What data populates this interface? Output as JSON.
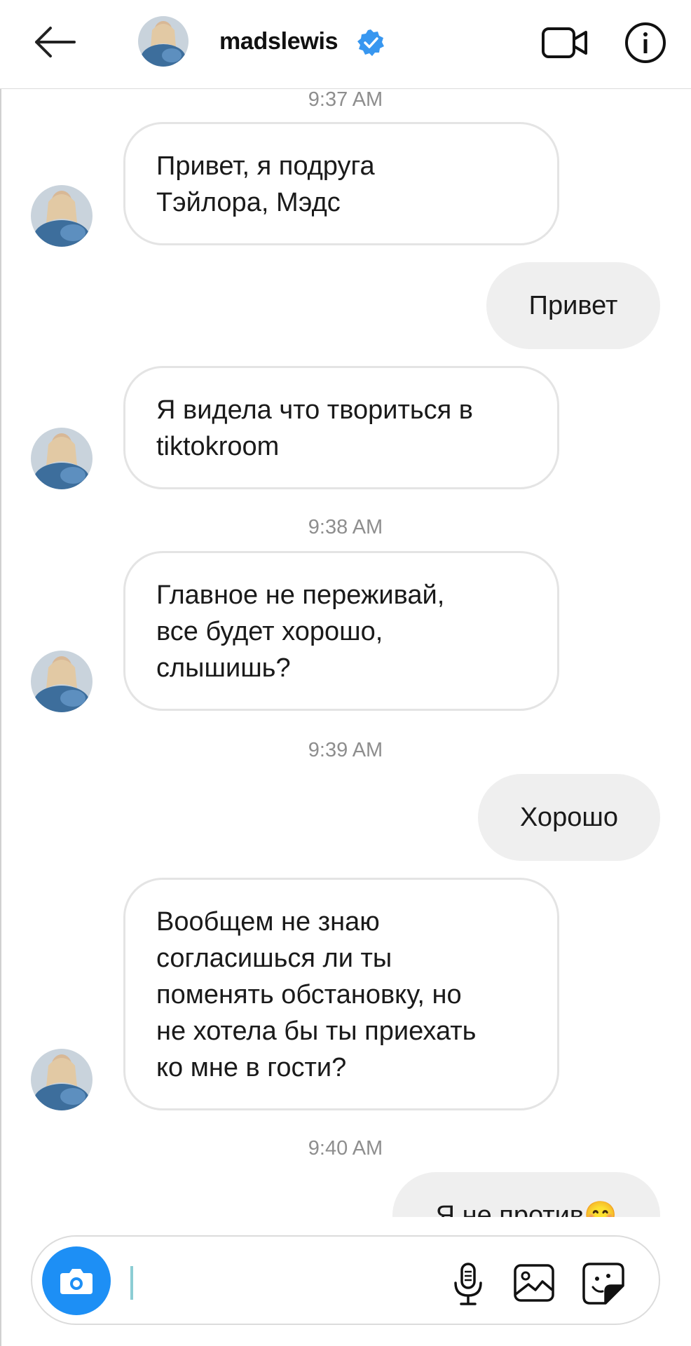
{
  "header": {
    "username": "madslewis",
    "verified": true,
    "icons": [
      "back-arrow-icon",
      "verified-badge-icon",
      "video-call-icon",
      "info-icon"
    ]
  },
  "messages": [
    {
      "type": "timestamp",
      "text": "9:37 AM"
    },
    {
      "type": "incoming",
      "text": "Привет, я подруга\nТэйлора, Мэдс"
    },
    {
      "type": "outgoing",
      "text": "Привет"
    },
    {
      "type": "incoming",
      "text": "Я видела что твориться в\ntiktokroom"
    },
    {
      "type": "timestamp",
      "text": "9:38 AM"
    },
    {
      "type": "incoming",
      "text": "Главное не переживай,\nвсе будет хорошо,\nслышишь?"
    },
    {
      "type": "timestamp",
      "text": "9:39 AM"
    },
    {
      "type": "outgoing",
      "text": "Хорошо"
    },
    {
      "type": "incoming",
      "text": "Вообщем не знаю\nсогласишься ли ты\nпоменять обстановку, но\nне хотела бы ты приехать\nко мне в гости?"
    },
    {
      "type": "timestamp",
      "text": "9:40 AM"
    },
    {
      "type": "outgoing",
      "text": "Я не против😊"
    }
  ],
  "composer": {
    "value": "",
    "icons": [
      "camera-icon",
      "microphone-icon",
      "gallery-icon",
      "sticker-icon"
    ]
  },
  "colors": {
    "camera_button": "#1d8ff5",
    "verified_badge": "#3897f0",
    "outgoing_bubble": "#efefef",
    "incoming_border": "#e4e4e4",
    "timestamp": "#8e8e8e"
  }
}
